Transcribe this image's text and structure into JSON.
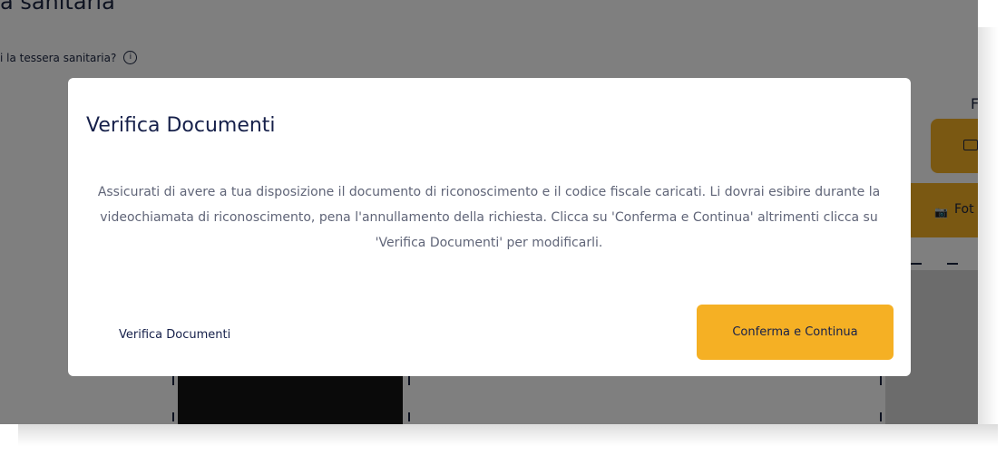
{
  "background": {
    "page_title": "a sanitaria",
    "health_card_question": "i la tessera sanitaria?",
    "info_icon_glyph": "i",
    "right_partial_letter": "F",
    "photo_button_partial_label": "Fot",
    "photo_icon_glyph": "📷"
  },
  "modal": {
    "title": "Verifica Documenti",
    "body": "Assicurati di avere a tua disposizione il documento di riconoscimento e il codice fiscale caricati. Li dovrai esibire durante la videochiamata di riconoscimento, pena l'annullamento della richiesta. Clicca su 'Conferma e Continua' altrimenti clicca su 'Verifica Documenti' per modificarli.",
    "verify_button_label": "Verifica Documenti",
    "confirm_button_label": "Conferma e Continua"
  },
  "colors": {
    "accent": "#f5b024",
    "text_primary": "#16204a",
    "text_body": "#606578",
    "overlay": "rgba(0,0,0,0.5)"
  },
  "icons": {
    "info": "info-icon",
    "folder": "folder-icon",
    "camera": "camera-icon"
  }
}
